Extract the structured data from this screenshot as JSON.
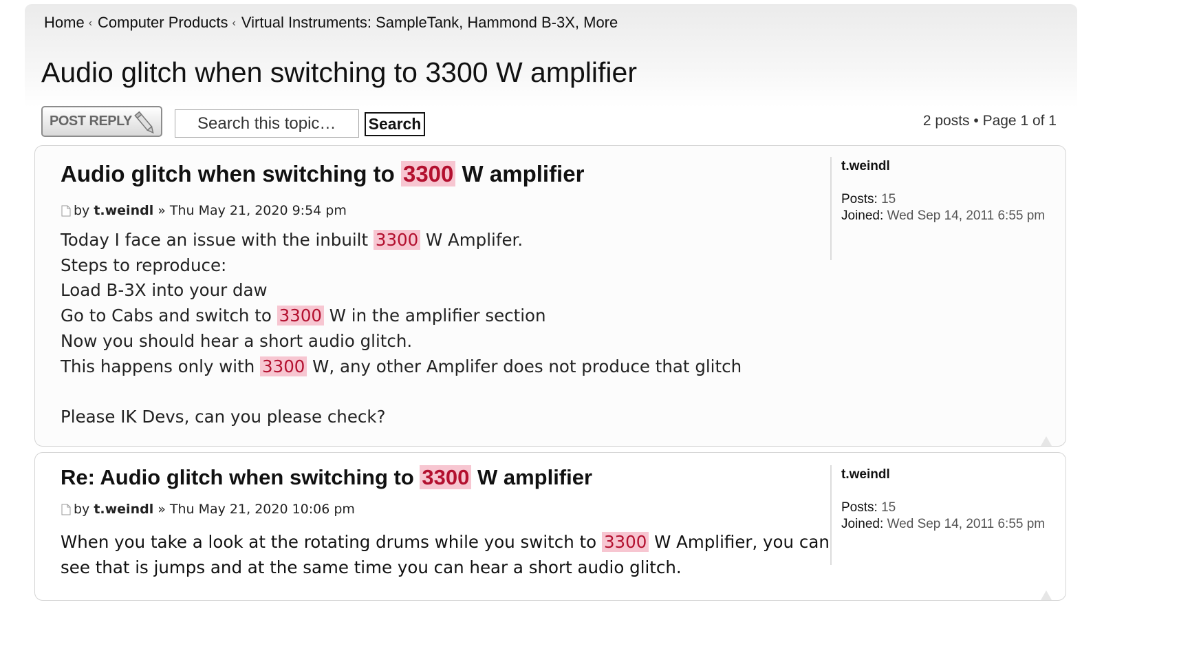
{
  "breadcrumb": {
    "items": [
      "Home",
      "Computer Products",
      "Virtual Instruments: SampleTank, Hammond B-3X, More"
    ],
    "separator": "‹"
  },
  "topic": {
    "title": "Audio glitch when switching to 3300 W amplifier"
  },
  "toolbar": {
    "post_reply_label": "POST REPLY",
    "search_placeholder": "Search this topic…",
    "search_button_label": "Search",
    "pagination": "2 posts • Page 1 of 1"
  },
  "highlight_term": "3300",
  "colors": {
    "highlight_bg": "#f7c6d1",
    "highlight_text": "#b3102f"
  },
  "posts": [
    {
      "title_pre": "Audio glitch when switching to ",
      "title_hl": "3300",
      "title_post": " W amplifier",
      "by": "by",
      "author": "t.weindl",
      "date": "» Thu May 21, 2020 9:54 pm",
      "body": [
        {
          "pre": "Today I face an issue with the inbuilt ",
          "hl": "3300",
          "post": " W Amplifer."
        },
        {
          "pre": "Steps to reproduce:",
          "hl": "",
          "post": ""
        },
        {
          "pre": "Load B-3X into your daw",
          "hl": "",
          "post": ""
        },
        {
          "pre": "Go to Cabs and switch to ",
          "hl": "3300",
          "post": " W in the amplifier section"
        },
        {
          "pre": "Now you should hear a short audio glitch.",
          "hl": "",
          "post": ""
        },
        {
          "pre": "This happens only with ",
          "hl": "3300",
          "post": " W, any other Amplifer does not produce that glitch"
        },
        {
          "pre": "",
          "hl": "",
          "post": ""
        },
        {
          "pre": "Please IK Devs, can you please check?",
          "hl": "",
          "post": ""
        }
      ],
      "profile": {
        "name": "t.weindl",
        "posts_label": "Posts:",
        "posts_value": "15",
        "joined_label": "Joined:",
        "joined_value": "Wed Sep 14, 2011 6:55 pm"
      }
    },
    {
      "title_pre": "Re: Audio glitch when switching to ",
      "title_hl": "3300",
      "title_post": " W amplifier",
      "by": "by",
      "author": "t.weindl",
      "date": "» Thu May 21, 2020 10:06 pm",
      "body_pre": "When you take a look at the rotating drums while you switch to ",
      "body_hl": "3300",
      "body_post": " W Amplifier, you can see that is jumps and at the same time you can hear a short audio glitch.",
      "profile": {
        "name": "t.weindl",
        "posts_label": "Posts:",
        "posts_value": "15",
        "joined_label": "Joined:",
        "joined_value": "Wed Sep 14, 2011 6:55 pm"
      }
    }
  ]
}
